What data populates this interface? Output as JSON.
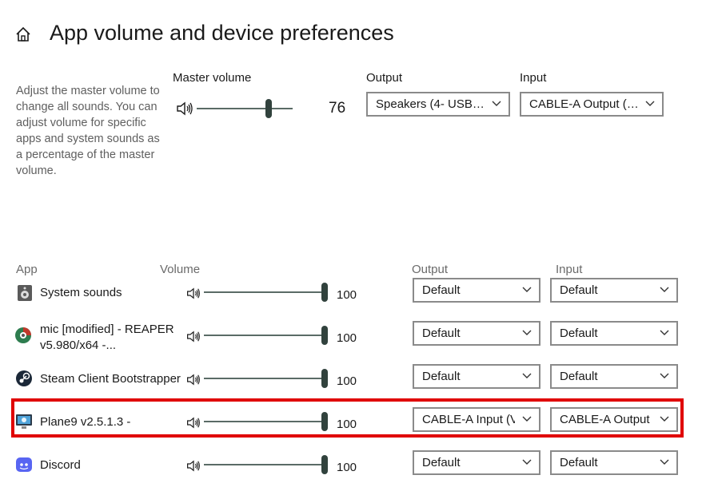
{
  "header": {
    "title": "App volume and device preferences"
  },
  "description": "Adjust the master volume to change all sounds. You can adjust volume for specific apps and system sounds as a percentage of the master volume.",
  "master": {
    "label": "Master volume",
    "value": "76",
    "level": 76,
    "output_label": "Output",
    "output_value": "Speakers (4- USB…",
    "input_label": "Input",
    "input_value": "CABLE-A Output (…"
  },
  "columns": {
    "app": "App",
    "volume": "Volume",
    "output": "Output",
    "input": "Input"
  },
  "apps": [
    {
      "name": "System sounds",
      "volume": "100",
      "level": 100,
      "output": "Default",
      "input": "Default",
      "icon": "system-sounds-icon"
    },
    {
      "name": "mic [modified] - REAPER v5.980/x64 -...",
      "volume": "100",
      "level": 100,
      "output": "Default",
      "input": "Default",
      "icon": "reaper-icon"
    },
    {
      "name": "Steam Client Bootstrapper",
      "volume": "100",
      "level": 100,
      "output": "Default",
      "input": "Default",
      "icon": "steam-icon"
    },
    {
      "name": "Plane9 v2.5.1.3 -",
      "volume": "100",
      "level": 100,
      "output": "CABLE-A Input (V",
      "input": "CABLE-A Output (",
      "icon": "plane9-icon"
    },
    {
      "name": "Discord",
      "volume": "100",
      "level": 100,
      "output": "Default",
      "input": "Default",
      "icon": "discord-icon"
    }
  ],
  "colors": {
    "highlight": "#e00000",
    "slider_thumb": "#31423d",
    "dropdown_border": "#8a8a8a"
  }
}
